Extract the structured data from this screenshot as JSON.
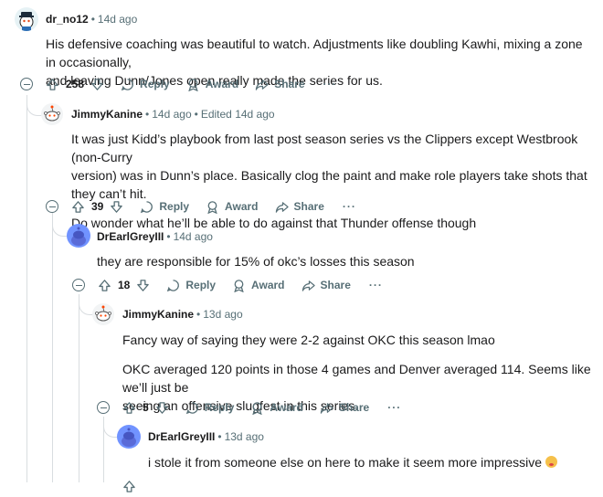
{
  "actions": {
    "reply": "Reply",
    "award": "Award",
    "share": "Share",
    "more": "···"
  },
  "comments": [
    {
      "user": "dr_no12",
      "age": "14d ago",
      "edited": "",
      "score": "258",
      "paragraphs": [
        "His defensive coaching was beautiful to watch. Adjustments like doubling Kawhi, mixing a zone in occasionally,",
        "and leaving Dunn/Jones open really made the series for us."
      ]
    },
    {
      "user": "JimmyKanine",
      "age": "14d ago",
      "edited": "Edited 14d ago",
      "score": "39",
      "paragraphs": [
        "It was just Kidd’s playbook from last post season series vs the Clippers except Westbrook (non-Curry",
        "version) was in Dunn’s place. Basically clog the paint and make role players take shots that they can’t hit.",
        "Do wonder what he’ll be able to do against that Thunder offense though"
      ]
    },
    {
      "user": "DrEarlGreyIII",
      "age": "14d ago",
      "edited": "",
      "score": "18",
      "paragraphs": [
        "they are responsible for 15% of okc’s losses this season"
      ]
    },
    {
      "user": "JimmyKanine",
      "age": "13d ago",
      "edited": "",
      "score": "5",
      "paragraphs": [
        "Fancy way of saying they were 2-2 against OKC this season lmao",
        "OKC averaged 120 points in those 4 games and Denver averaged 114. Seems like we’ll just be",
        "seeing an offensive slugfest in this series."
      ]
    },
    {
      "user": "DrEarlGreyIII",
      "age": "13d ago",
      "edited": "",
      "paragraphs": [
        "i stole it from someone else on here to make it seem more impressive"
      ]
    }
  ],
  "colors": {
    "meta": "#576f76",
    "line": "#d9dde0",
    "avatar_blue": "#7193ff"
  }
}
